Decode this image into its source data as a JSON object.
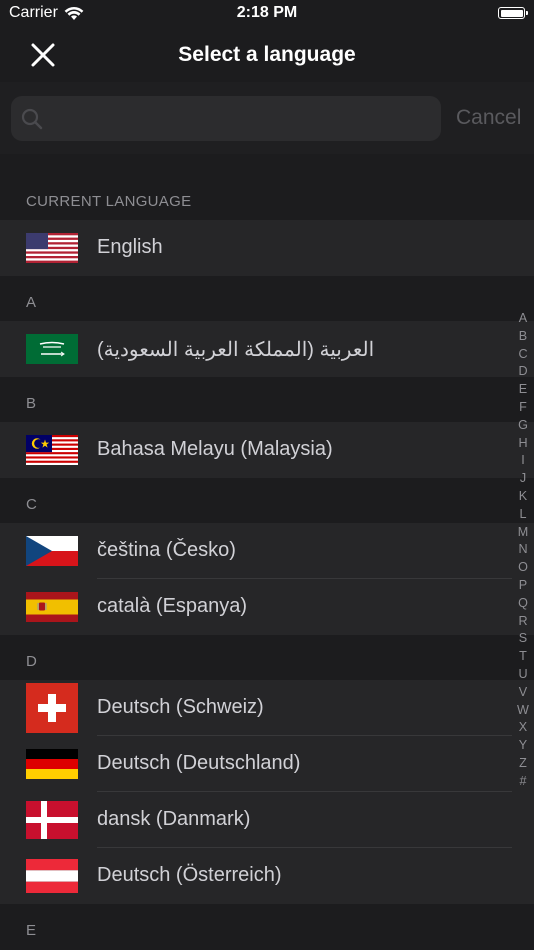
{
  "status_bar": {
    "carrier": "Carrier",
    "time": "2:18 PM"
  },
  "nav": {
    "title": "Select a language"
  },
  "search": {
    "placeholder": "",
    "cancel_label": "Cancel"
  },
  "sections": {
    "current": {
      "header": "CURRENT LANGUAGE",
      "rows": [
        {
          "label": "English",
          "flag": "us-flag-icon"
        }
      ]
    },
    "a": {
      "header": "A",
      "rows": [
        {
          "label": "العربية (المملكة العربية السعودية)",
          "flag": "saudi-flag-icon"
        }
      ]
    },
    "b": {
      "header": "B",
      "rows": [
        {
          "label": "Bahasa Melayu (Malaysia)",
          "flag": "malaysia-flag-icon"
        }
      ]
    },
    "c": {
      "header": "C",
      "rows": [
        {
          "label": "čeština (Česko)",
          "flag": "czech-flag-icon"
        },
        {
          "label": "català (Espanya)",
          "flag": "spain-flag-icon"
        }
      ]
    },
    "d": {
      "header": "D",
      "rows": [
        {
          "label": "Deutsch (Schweiz)",
          "flag": "swiss-flag-icon"
        },
        {
          "label": "Deutsch (Deutschland)",
          "flag": "germany-flag-icon"
        },
        {
          "label": "dansk (Danmark)",
          "flag": "denmark-flag-icon"
        },
        {
          "label": "Deutsch (Österreich)",
          "flag": "austria-flag-icon"
        }
      ]
    },
    "e": {
      "header": "E"
    }
  },
  "index_letters": [
    "A",
    "B",
    "C",
    "D",
    "E",
    "F",
    "G",
    "H",
    "I",
    "J",
    "K",
    "L",
    "M",
    "N",
    "O",
    "P",
    "Q",
    "R",
    "S",
    "T",
    "U",
    "V",
    "W",
    "X",
    "Y",
    "Z",
    "#"
  ],
  "colors": {
    "background": "#1c1c1e",
    "row": "#262628",
    "header_text": "#8e8e93",
    "cancel_disabled": "#5a5a5e"
  }
}
